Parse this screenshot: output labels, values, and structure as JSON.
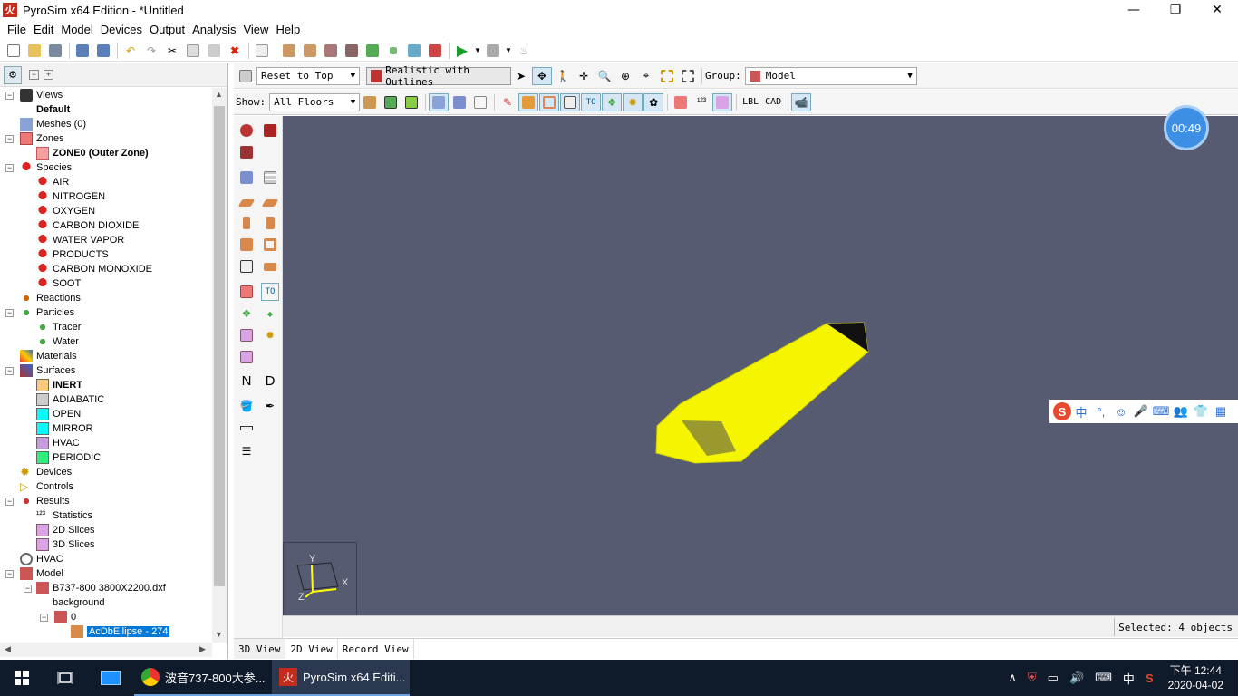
{
  "window": {
    "title": "PyroSim x64 Edition - *Untitled",
    "app_glyph": "火",
    "min": "—",
    "max": "❐",
    "close": "✕"
  },
  "menu": [
    "File",
    "Edit",
    "Model",
    "Devices",
    "Output",
    "Analysis",
    "View",
    "Help"
  ],
  "tree": {
    "views": "Views",
    "default": "Default",
    "meshes": "Meshes (0)",
    "zones": "Zones",
    "zone0": "ZONE0 (Outer Zone)",
    "species": "Species",
    "species_items": [
      "AIR",
      "NITROGEN",
      "OXYGEN",
      "CARBON DIOXIDE",
      "WATER VAPOR",
      "PRODUCTS",
      "CARBON MONOXIDE",
      "SOOT"
    ],
    "reactions": "Reactions",
    "particles": "Particles",
    "tracer": "Tracer",
    "water": "Water",
    "materials": "Materials",
    "surfaces": "Surfaces",
    "surface_items": [
      {
        "label": "INERT",
        "color": "#ffc87a"
      },
      {
        "label": "ADIABATIC",
        "color": "#cccccc"
      },
      {
        "label": "OPEN",
        "color": "#00ffff"
      },
      {
        "label": "MIRROR",
        "color": "#00ffff"
      },
      {
        "label": "HVAC",
        "color": "#c89be0"
      },
      {
        "label": "PERIODIC",
        "color": "#2cf07a"
      }
    ],
    "devices": "Devices",
    "controls": "Controls",
    "results": "Results",
    "statistics": "Statistics",
    "slices2d": "2D Slices",
    "slices3d": "3D Slices",
    "hvac": "HVAC",
    "model": "Model",
    "dxf": "B737-800 3800X2200.dxf",
    "background": "background",
    "zero": "0",
    "ellipse": "AcDbEllipse - 274"
  },
  "toolbar": {
    "reset_view": "Reset to Top",
    "render_mode": "Realistic with Outlines",
    "group_label": "Group:",
    "group_value": "Model",
    "show_label": "Show:",
    "floors": "All Floors",
    "lbl": "LBL",
    "cad": "CAD",
    "n": "N",
    "d": "D",
    "to": "TO"
  },
  "viewport": {
    "background": "#565b71",
    "object_color": "#f5f500",
    "timer": "00:49",
    "axis_x": "X",
    "axis_y": "Y",
    "axis_z": "Z"
  },
  "ime": {
    "logo": "S",
    "items": [
      "中",
      "°,",
      "☺",
      "🎤",
      "⌨",
      "👥",
      "👕",
      "▦"
    ]
  },
  "status": {
    "selected": "Selected: 4 objects"
  },
  "tabs": [
    "3D View",
    "2D View",
    "Record View"
  ],
  "taskbar": {
    "chrome": "波音737-800大参...",
    "pyrosim": "PyroSim x64 Editi...",
    "tray_caret": "∧",
    "lang": "中",
    "time": "下午 12:44",
    "date": "2020-04-02"
  }
}
